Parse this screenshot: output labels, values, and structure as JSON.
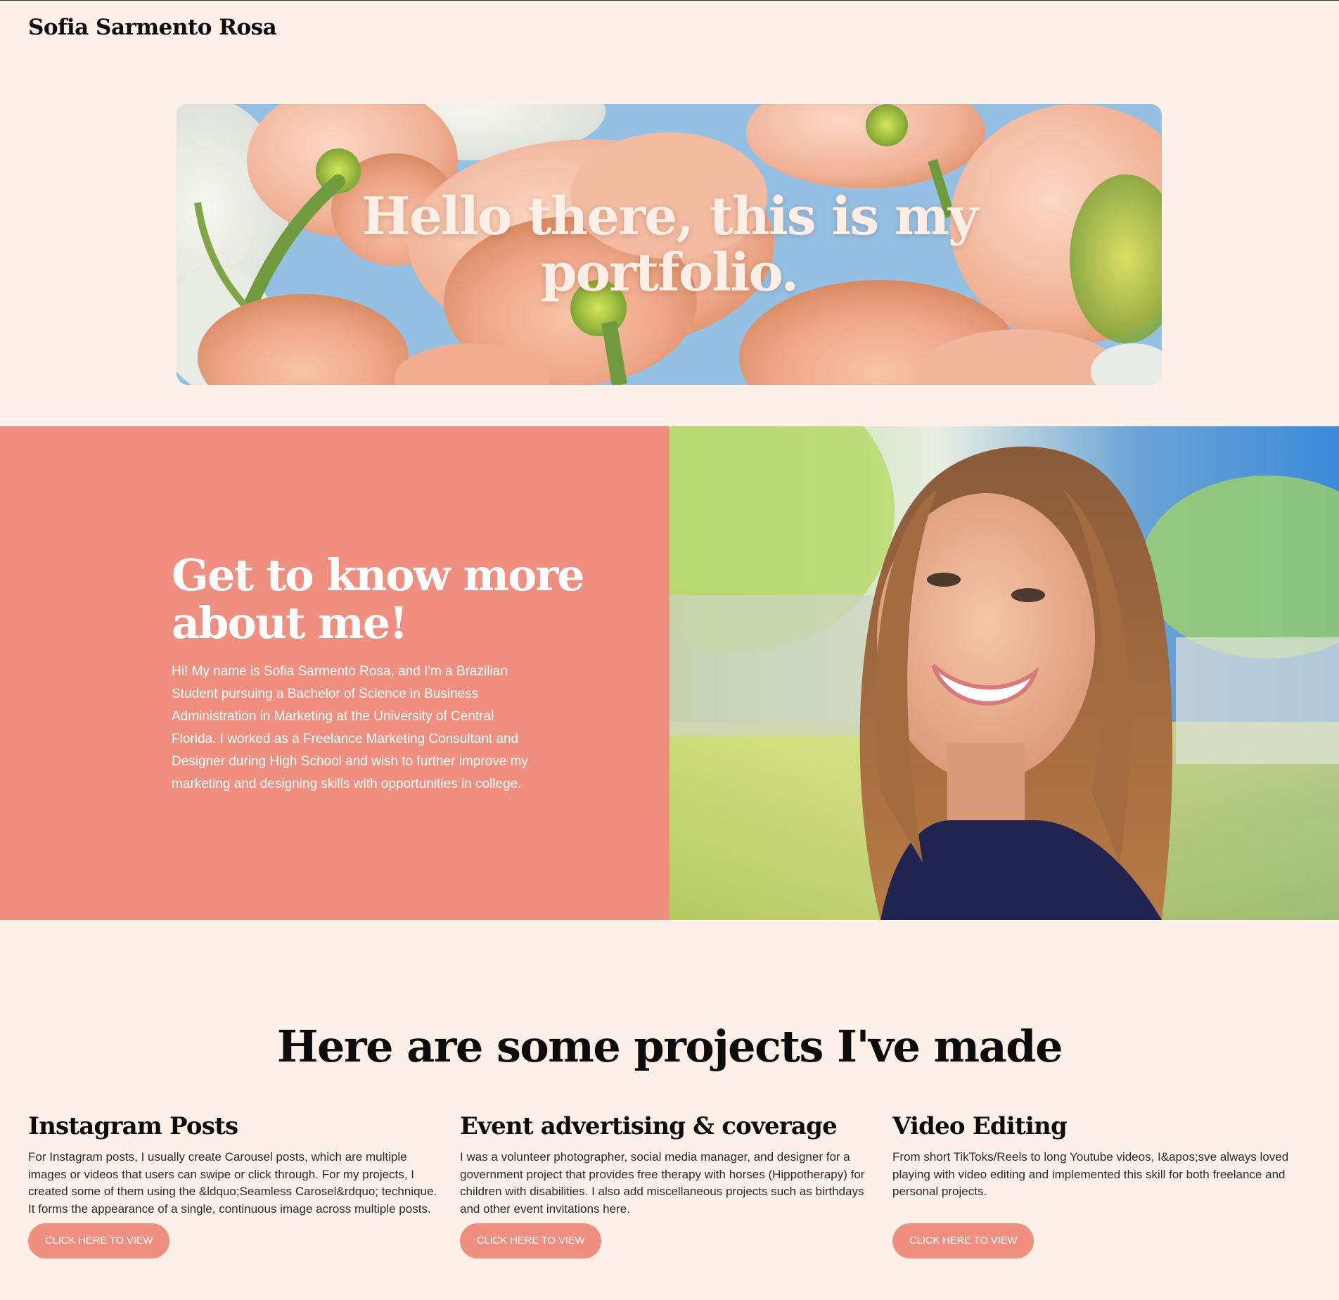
{
  "header": {
    "site_title": "Sofia Sarmento Rosa"
  },
  "hero": {
    "heading": "Hello there, this is my portfolio."
  },
  "about": {
    "heading": "Get to know more about me!",
    "body": "Hi! My name is Sofia Sarmento Rosa, and I'm a Brazilian Student pursuing a Bachelor of Science in Business Administration in Marketing at the University of Central Florida. I worked as a Freelance Marketing Consultant and Designer during High School and wish to further improve my marketing and designing skills with opportunities in college."
  },
  "projects": {
    "heading": "Here are some projects I've made",
    "items": [
      {
        "title": "Instagram Posts",
        "description": "For Instagram posts, I usually create Carousel posts, which are multiple images or videos that users can swipe or click through. For my projects, I created some of them using the &ldquo;Seamless Carosel&rdquo; technique. It forms the appearance of a single, continuous image across multiple posts.",
        "button_label": "CLICK HERE TO VIEW"
      },
      {
        "title": "Event advertising & coverage",
        "description": "I was a volunteer photographer, social media manager, and designer for a government project that provides free therapy with horses (Hippotherapy) for children with disabilities. I also add miscellaneous projects such as birthdays and other event invitations here.",
        "button_label": "CLICK HERE TO VIEW"
      },
      {
        "title": "Video Editing",
        "description": "From short TikToks/Reels to long Youtube videos, I&apos;sve always loved playing with video editing and implemented this skill for both freelance and personal projects.",
        "button_label": "CLICK HERE TO VIEW"
      }
    ]
  },
  "colors": {
    "background": "#fdf0e8",
    "accent": "#ef8f7f",
    "text": "#0c0c0c"
  }
}
